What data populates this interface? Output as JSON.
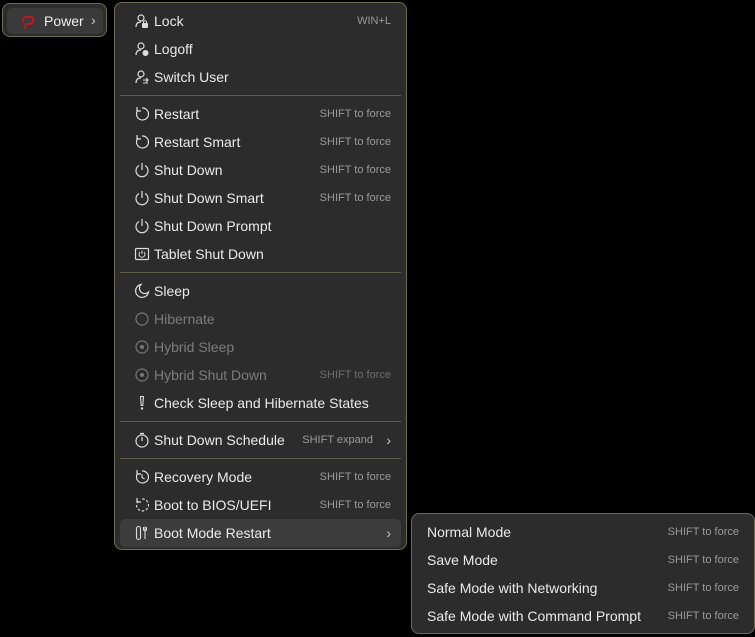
{
  "power_button": {
    "label": "Power",
    "chevron": "›",
    "icon": "power-logo-icon",
    "accent_color": "#c4161c"
  },
  "main_menu": {
    "items": [
      {
        "id": "lock",
        "label": "Lock",
        "shortcut": "WIN+L",
        "icon": "lock-icon"
      },
      {
        "id": "logoff",
        "label": "Logoff",
        "icon": "logoff-icon"
      },
      {
        "id": "switch-user",
        "label": "Switch User",
        "icon": "switch-user-icon"
      },
      {
        "id": "restart",
        "label": "Restart",
        "shortcut": "SHIFT to force",
        "icon": "restart-icon"
      },
      {
        "id": "restart-smart",
        "label": "Restart Smart",
        "shortcut": "SHIFT to force",
        "icon": "restart-icon"
      },
      {
        "id": "shut-down",
        "label": "Shut Down",
        "shortcut": "SHIFT to force",
        "icon": "power-icon"
      },
      {
        "id": "shut-down-smart",
        "label": "Shut Down Smart",
        "shortcut": "SHIFT to force",
        "icon": "power-icon"
      },
      {
        "id": "shut-down-prompt",
        "label": "Shut Down Prompt",
        "icon": "power-icon"
      },
      {
        "id": "tablet-shut-down",
        "label": "Tablet Shut Down",
        "icon": "tablet-icon"
      },
      {
        "id": "sleep",
        "label": "Sleep",
        "icon": "moon-icon"
      },
      {
        "id": "hibernate",
        "label": "Hibernate",
        "icon": "circle-icon"
      },
      {
        "id": "hybrid-sleep",
        "label": "Hybrid Sleep",
        "icon": "target-icon"
      },
      {
        "id": "hybrid-shut-down",
        "label": "Hybrid Shut Down",
        "shortcut": "SHIFT to force",
        "icon": "target-icon"
      },
      {
        "id": "check-sleep",
        "label": "Check Sleep and Hibernate States",
        "icon": "exclamation-icon"
      },
      {
        "id": "shut-down-schedule",
        "label": "Shut Down Schedule",
        "shortcut": "SHIFT expand",
        "chevron": "›",
        "icon": "timer-icon"
      },
      {
        "id": "recovery-mode",
        "label": "Recovery Mode",
        "shortcut": "SHIFT to force",
        "icon": "recovery-icon"
      },
      {
        "id": "boot-bios",
        "label": "Boot to BIOS/UEFI",
        "shortcut": "SHIFT to force",
        "icon": "dashed-refresh-icon"
      },
      {
        "id": "boot-mode-restart",
        "label": "Boot Mode Restart",
        "chevron": "›",
        "icon": "tools-icon"
      }
    ]
  },
  "sub_menu": {
    "items": [
      {
        "label": "Normal Mode",
        "shortcut": "SHIFT to force"
      },
      {
        "label": "Save Mode",
        "shortcut": "SHIFT to force"
      },
      {
        "label": "Safe Mode with Networking",
        "shortcut": "SHIFT to force"
      },
      {
        "label": "Safe Mode with Command Prompt",
        "shortcut": "SHIFT to force"
      }
    ]
  }
}
